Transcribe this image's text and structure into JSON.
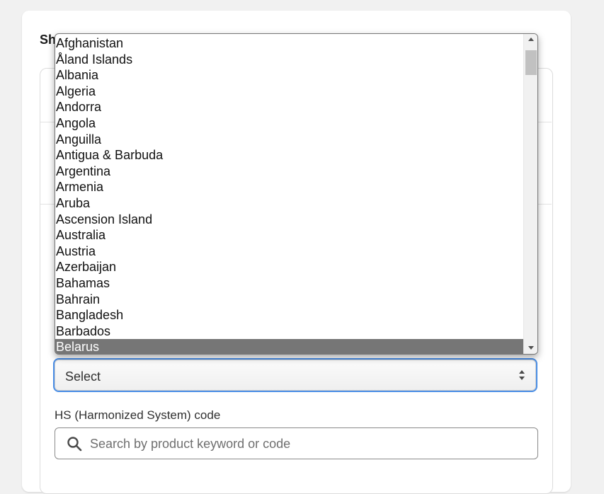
{
  "section": {
    "title": "Sh"
  },
  "country_select": {
    "value": "Select",
    "options": [
      "Afghanistan",
      "Åland Islands",
      "Albania",
      "Algeria",
      "Andorra",
      "Angola",
      "Anguilla",
      "Antigua & Barbuda",
      "Argentina",
      "Armenia",
      "Aruba",
      "Ascension Island",
      "Australia",
      "Austria",
      "Azerbaijan",
      "Bahamas",
      "Bahrain",
      "Bangladesh",
      "Barbados",
      "Belarus"
    ],
    "highlighted": "Belarus"
  },
  "hs_code": {
    "label": "HS (Harmonized System) code",
    "placeholder": "Search by product keyword or code"
  },
  "colors": {
    "focus_border": "#4a8ee6",
    "highlight_bg": "#767676"
  },
  "icons": {
    "search": "search-icon",
    "select_arrows": "up-down-arrows-icon"
  }
}
